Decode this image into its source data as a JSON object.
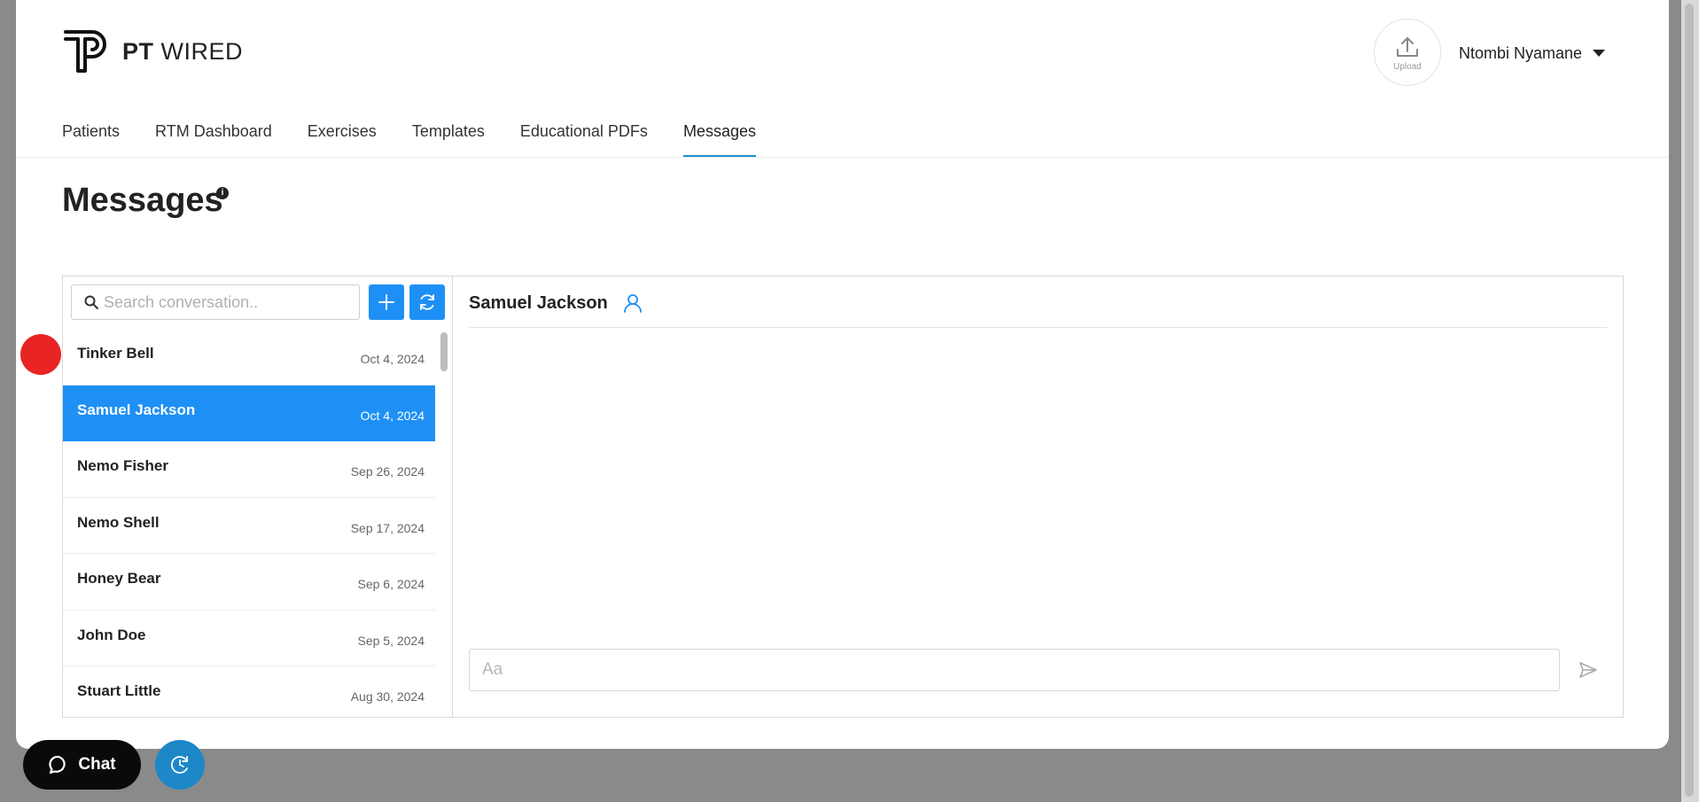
{
  "brand": {
    "bold": "PT",
    "light": "WIRED"
  },
  "header": {
    "upload_label": "Upload",
    "user_name": "Ntombi Nyamane"
  },
  "nav": [
    {
      "label": "Patients"
    },
    {
      "label": "RTM Dashboard"
    },
    {
      "label": "Exercises"
    },
    {
      "label": "Templates"
    },
    {
      "label": "Educational PDFs"
    },
    {
      "label": "Messages",
      "active": true
    }
  ],
  "page": {
    "title": "Messages",
    "info_glyph": "i"
  },
  "search": {
    "placeholder": "Search conversation.."
  },
  "conversations": [
    {
      "name": "Tinker Bell",
      "date": "Oct 4, 2024"
    },
    {
      "name": "Samuel Jackson",
      "date": "Oct 4, 2024",
      "selected": true
    },
    {
      "name": "Nemo Fisher",
      "date": "Sep 26, 2024"
    },
    {
      "name": "Nemo Shell",
      "date": "Sep 17, 2024"
    },
    {
      "name": "Honey Bear",
      "date": "Sep 6, 2024"
    },
    {
      "name": "John Doe",
      "date": "Sep 5, 2024"
    },
    {
      "name": "Stuart Little",
      "date": "Aug 30, 2024"
    }
  ],
  "chat": {
    "recipient": "Samuel Jackson",
    "input_placeholder": "Aa"
  },
  "widgets": {
    "chat_label": "Chat"
  },
  "icons": {
    "logo": "pt-logo-icon",
    "upload": "upload-icon",
    "caret": "caret-down-icon",
    "search": "search-icon",
    "add": "plus-icon",
    "refresh": "refresh-icon",
    "profile": "user-icon",
    "send": "send-icon",
    "chat": "chat-bubble-icon",
    "clock": "clock-icon"
  },
  "colors": {
    "accent": "#1e90f5",
    "nav_underline": "#1f8fd4",
    "marker": "#e82424",
    "chat_pill": "#0a0a0a",
    "clock_button": "#1d87c8"
  }
}
